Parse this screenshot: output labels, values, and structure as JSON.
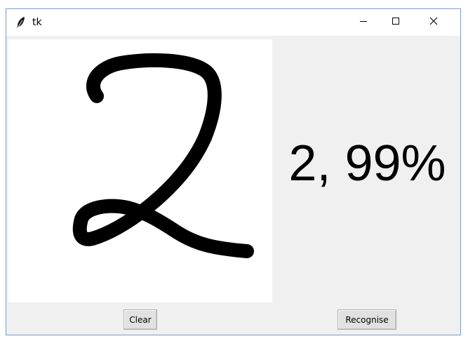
{
  "window": {
    "title": "tk",
    "icon": "feather-icon",
    "controls": [
      "minimize-icon",
      "maximize-icon",
      "close-icon"
    ]
  },
  "canvas": {
    "drawn_digit": "2",
    "stroke_color": "#000000",
    "background": "#ffffff"
  },
  "result": {
    "text": "2, 99%"
  },
  "buttons": {
    "clear_label": "Clear",
    "recognise_label": "Recognise"
  }
}
